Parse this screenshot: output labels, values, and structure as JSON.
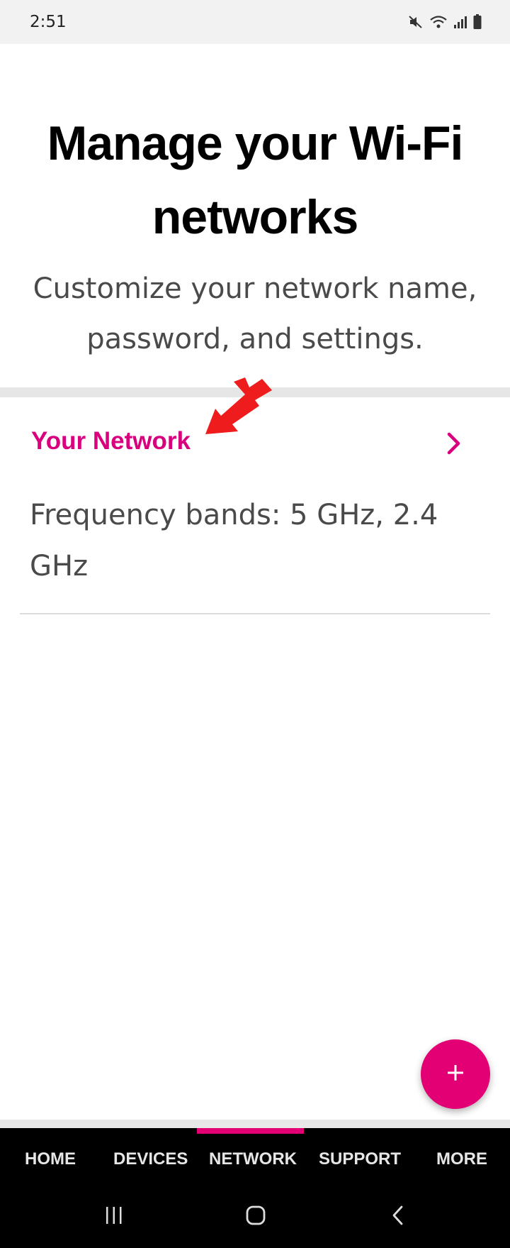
{
  "status_bar": {
    "time": "2:51",
    "icons": [
      "mute-icon",
      "wifi-icon",
      "signal-icon",
      "battery-icon"
    ]
  },
  "page": {
    "title_line1": "Manage your Wi-Fi",
    "title_line2": "networks",
    "subtitle_line1": "Customize your network name,",
    "subtitle_line2": "password, and settings."
  },
  "network": {
    "name": "Your Network",
    "frequency_line1": "Frequency bands: 5 GHz, 2.4",
    "frequency_line2": "GHz"
  },
  "fab": {
    "icon": "plus-icon",
    "label": "+"
  },
  "bottom_nav": {
    "active": "NETWORK",
    "items": [
      "HOME",
      "DEVICES",
      "NETWORK",
      "SUPPORT",
      "MORE"
    ]
  },
  "system_nav": [
    "recents-icon",
    "home-icon",
    "back-icon"
  ],
  "colors": {
    "accent": "#e20074",
    "link": "#d9007e",
    "annotation": "#ee1c1c"
  }
}
